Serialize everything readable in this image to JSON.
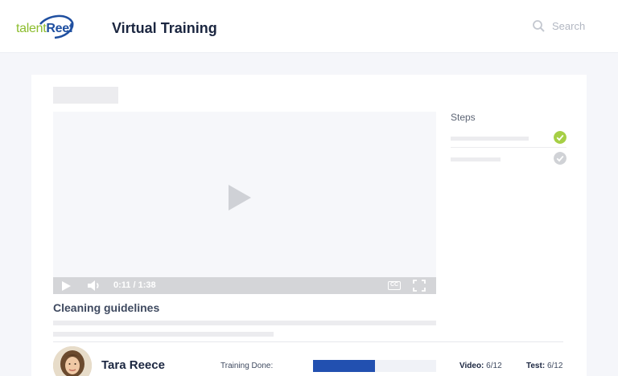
{
  "header": {
    "logo": {
      "part1": "talent",
      "part2": "Reef"
    },
    "title": "Virtual Training",
    "search": {
      "placeholder": "Search",
      "value": ""
    }
  },
  "video": {
    "time": "0:11 / 1:38",
    "cc_label": "CC",
    "title": "Cleaning guidelines"
  },
  "steps": {
    "label": "Steps",
    "items": [
      {
        "status": "complete",
        "check_color": "#a6cf45"
      },
      {
        "status": "pending",
        "check_color": "#d0d2d6"
      }
    ]
  },
  "user": {
    "name": "Tara Reece",
    "training_label": "Training Done:",
    "training_progress": 0.5,
    "progress_color": "#2250b0",
    "video_label": "Video:",
    "video_value": "6/12",
    "test_label": "Test:",
    "test_value": "6/12"
  },
  "icons": [
    "logo-swoosh-icon",
    "search-icon",
    "play-icon",
    "volume-icon",
    "closed-captions-icon",
    "fullscreen-icon",
    "check-circle-icon"
  ]
}
